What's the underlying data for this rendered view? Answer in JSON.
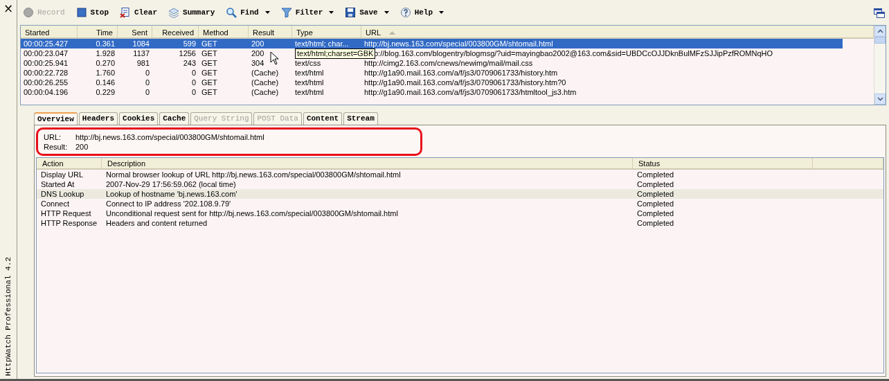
{
  "app_name": "HttpWatch Professional 4.2",
  "close_glyph": "×",
  "toolbar": [
    {
      "kind": "record",
      "label": "Record",
      "disabled": true,
      "dropdown": false
    },
    {
      "kind": "stop",
      "label": "Stop",
      "disabled": false,
      "dropdown": false
    },
    {
      "kind": "clear",
      "label": "Clear",
      "disabled": false,
      "dropdown": false
    },
    {
      "kind": "summary",
      "label": "Summary",
      "disabled": false,
      "dropdown": false
    },
    {
      "kind": "find",
      "label": "Find",
      "disabled": false,
      "dropdown": true
    },
    {
      "kind": "filter",
      "label": "Filter",
      "disabled": false,
      "dropdown": true
    },
    {
      "kind": "save",
      "label": "Save",
      "disabled": false,
      "dropdown": true
    },
    {
      "kind": "help",
      "label": "Help",
      "disabled": false,
      "dropdown": true
    }
  ],
  "requests": {
    "columns": [
      {
        "label": "Started",
        "sorted": false
      },
      {
        "label": "Time",
        "sorted": false
      },
      {
        "label": "Sent",
        "sorted": false
      },
      {
        "label": "Received",
        "sorted": false
      },
      {
        "label": "Method",
        "sorted": false
      },
      {
        "label": "Result",
        "sorted": false
      },
      {
        "label": "Type",
        "sorted": false
      },
      {
        "label": "URL",
        "sorted": true
      }
    ],
    "rows": [
      {
        "started": "00:00:25.427",
        "time": "0.361",
        "sent": "1084",
        "received": "599",
        "method": "GET",
        "result": "200",
        "type": "text/html; char...",
        "url": "http://bj.news.163.com/special/003800GM/shtomail.html",
        "selected": true
      },
      {
        "started": "00:00:23.047",
        "time": "1.928",
        "sent": "1137",
        "received": "1256",
        "method": "GET",
        "result": "200",
        "tooltip": "text/html;charset=GBK",
        "url": "p://blog.163.com/blogentry/blogmsg/?uid=mayingbao2002@163.com&sid=UBDCcOJJDknBulMFzSJJipPzfROMNqHO",
        "selected": false
      },
      {
        "started": "00:00:25.941",
        "time": "0.270",
        "sent": "981",
        "received": "243",
        "method": "GET",
        "result": "304",
        "type": "text/css",
        "url": "http://cimg2.163.com/cnews/newimg/mail/mail.css",
        "selected": false
      },
      {
        "started": "00:00:22.728",
        "time": "1.760",
        "sent": "0",
        "received": "0",
        "method": "GET",
        "result": "(Cache)",
        "type": "text/html",
        "url": "http://g1a90.mail.163.com/a/f/js3/0709061733/history.htm",
        "selected": false
      },
      {
        "started": "00:00:26.255",
        "time": "0.146",
        "sent": "0",
        "received": "0",
        "method": "GET",
        "result": "(Cache)",
        "type": "text/html",
        "url": "http://g1a90.mail.163.com/a/f/js3/0709061733/history.htm?0",
        "selected": false
      },
      {
        "started": "00:00:04.196",
        "time": "0.229",
        "sent": "0",
        "received": "0",
        "method": "GET",
        "result": "(Cache)",
        "type": "text/html",
        "url": "http://g1a90.mail.163.com/a/f/js3/0709061733/htmltool_js3.htm",
        "selected": false
      }
    ]
  },
  "tabs": [
    {
      "label": "Overview",
      "selected": true,
      "disabled": false
    },
    {
      "label": "Headers",
      "selected": false,
      "disabled": false
    },
    {
      "label": "Cookies",
      "selected": false,
      "disabled": false
    },
    {
      "label": "Cache",
      "selected": false,
      "disabled": false
    },
    {
      "label": "Query String",
      "selected": false,
      "disabled": true
    },
    {
      "label": "POST Data",
      "selected": false,
      "disabled": true
    },
    {
      "label": "Content",
      "selected": false,
      "disabled": false
    },
    {
      "label": "Stream",
      "selected": false,
      "disabled": false
    }
  ],
  "overview": {
    "highlighted": true,
    "fields": [
      {
        "label": "URL:",
        "value": "http://bj.news.163.com/special/003800GM/shtomail.html"
      },
      {
        "label": "Result:",
        "value": "200"
      }
    ]
  },
  "actions": {
    "columns": [
      "Action",
      "Description",
      "Status"
    ],
    "rows": [
      {
        "action": "Display URL",
        "description": "Normal browser lookup of URL http://bj.news.163.com/special/003800GM/shtomail.html",
        "status": "Completed",
        "highlighted": false
      },
      {
        "action": "Started At",
        "description": "2007-Nov-29 17:56:59.062 (local time)",
        "status": "Completed",
        "highlighted": false
      },
      {
        "action": "DNS Lookup",
        "description": "Lookup of hostname 'bj.news.163.com'",
        "status": "Completed",
        "highlighted": true
      },
      {
        "action": "Connect",
        "description": "Connect to IP address '202.108.9.79'",
        "status": "Completed",
        "highlighted": false
      },
      {
        "action": "HTTP Request",
        "description": "Unconditional request sent for http://bj.news.163.com/special/003800GM/shtomail.html",
        "status": "Completed",
        "highlighted": false
      },
      {
        "action": "HTTP Response",
        "description": "Headers and content returned",
        "status": "Completed",
        "highlighted": false
      }
    ]
  }
}
